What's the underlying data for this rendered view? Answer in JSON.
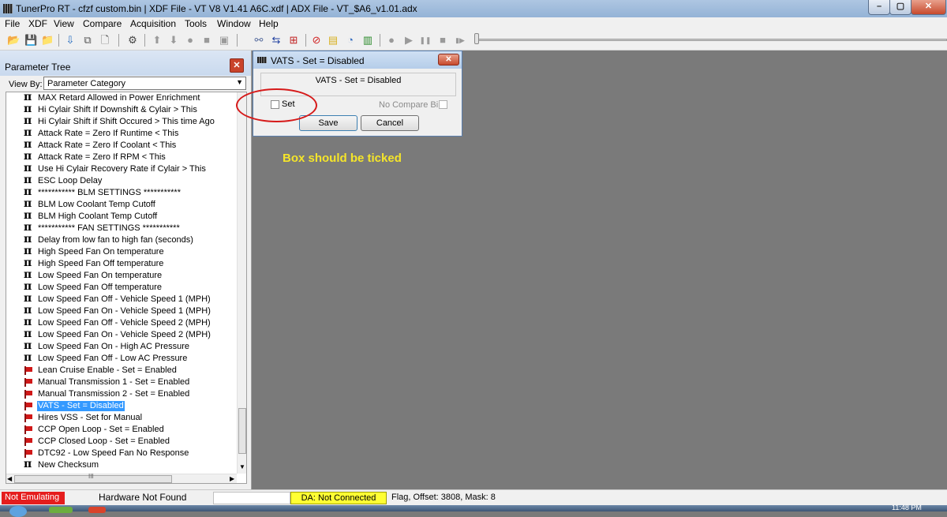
{
  "window": {
    "title": "TunerPro RT - cfzf custom.bin | XDF File - VT V8 V1.41 A6C.xdf | ADX File - VT_$A6_v1.01.adx",
    "min_glyph": "–",
    "max_glyph": "▢",
    "close_glyph": "✕"
  },
  "menu": [
    "File",
    "XDF",
    "View",
    "Compare",
    "Acquisition",
    "Tools",
    "Window",
    "Help"
  ],
  "toolbar": {
    "icons": [
      {
        "name": "open-folder-icon",
        "glyph": "📂"
      },
      {
        "name": "save-icon",
        "glyph": "💾"
      },
      {
        "name": "folder-icon",
        "glyph": "📁"
      },
      {
        "name": "import-icon",
        "glyph": "⇩"
      },
      {
        "name": "compare-icon",
        "glyph": "⧉"
      },
      {
        "name": "new-document-icon",
        "glyph": "🗋"
      },
      {
        "name": "tune-icon",
        "glyph": "⚙"
      },
      {
        "name": "arrow-up-icon",
        "glyph": "⬆"
      },
      {
        "name": "arrow-down-icon",
        "glyph": "⬇"
      },
      {
        "name": "record-icon",
        "glyph": "●"
      },
      {
        "name": "stop-square-icon",
        "glyph": "■"
      },
      {
        "name": "chip-icon",
        "glyph": "▣"
      },
      {
        "name": "connect-icon",
        "glyph": "⚯"
      },
      {
        "name": "swap-icon",
        "glyph": "⇆"
      },
      {
        "name": "emulate-icon",
        "glyph": "⊞"
      },
      {
        "name": "no-entry-icon",
        "glyph": "⊘"
      },
      {
        "name": "notes-icon",
        "glyph": "▤"
      },
      {
        "name": "gauge-icon",
        "glyph": "◔"
      },
      {
        "name": "bar-chart-icon",
        "glyph": "▥"
      },
      {
        "name": "playback-record-icon",
        "glyph": "●"
      },
      {
        "name": "play-icon",
        "glyph": "▶"
      },
      {
        "name": "pause-icon",
        "glyph": "❚❚"
      },
      {
        "name": "stop-icon",
        "glyph": "■"
      },
      {
        "name": "step-icon",
        "glyph": "▮▶"
      }
    ],
    "playback_position": 0
  },
  "panel": {
    "title": "Parameter Tree",
    "close_glyph": "✕",
    "view_by_label": "View By:",
    "view_by_value": "Parameter Category",
    "select_arrow": "▼"
  },
  "tree_items": [
    {
      "icon": "pi",
      "label": "MAX Retard Allowed in Power Enrichment"
    },
    {
      "icon": "pi",
      "label": "Hi Cylair Shift If Downshift & Cylair > This"
    },
    {
      "icon": "pi",
      "label": "Hi Cylair Shift if Shift Occured > This time Ago"
    },
    {
      "icon": "pi",
      "label": "Attack Rate = Zero If Runtime < This"
    },
    {
      "icon": "pi",
      "label": "Attack Rate = Zero If Coolant < This"
    },
    {
      "icon": "pi",
      "label": "Attack Rate = Zero If RPM < This"
    },
    {
      "icon": "pi",
      "label": "Use Hi Cylair Recovery Rate if Cylair > This"
    },
    {
      "icon": "pi",
      "label": "ESC Loop Delay"
    },
    {
      "icon": "pi",
      "label": "*********** BLM SETTINGS ***********"
    },
    {
      "icon": "pi",
      "label": "BLM Low Coolant Temp Cutoff"
    },
    {
      "icon": "pi",
      "label": "BLM High Coolant Temp Cutoff"
    },
    {
      "icon": "pi",
      "label": "*********** FAN SETTINGS ***********"
    },
    {
      "icon": "pi",
      "label": "Delay from low fan to high fan (seconds)"
    },
    {
      "icon": "pi",
      "label": "High Speed Fan On temperature"
    },
    {
      "icon": "pi",
      "label": "High Speed Fan Off temperature"
    },
    {
      "icon": "pi",
      "label": "Low Speed Fan On temperature"
    },
    {
      "icon": "pi",
      "label": "Low Speed Fan Off temperature"
    },
    {
      "icon": "pi",
      "label": "Low Speed Fan Off - Vehicle Speed 1 (MPH)"
    },
    {
      "icon": "pi",
      "label": "Low Speed Fan On - Vehicle Speed 1 (MPH)"
    },
    {
      "icon": "pi",
      "label": "Low Speed Fan Off - Vehicle Speed 2 (MPH)"
    },
    {
      "icon": "pi",
      "label": "Low Speed Fan On - Vehicle Speed 2 (MPH)"
    },
    {
      "icon": "pi",
      "label": "Low Speed Fan On - High AC Pressure"
    },
    {
      "icon": "pi",
      "label": "Low Speed Fan Off - Low AC Pressure"
    },
    {
      "icon": "flag",
      "label": "Lean Cruise Enable - Set = Enabled"
    },
    {
      "icon": "flag",
      "label": "Manual Transmission 1 - Set = Enabled"
    },
    {
      "icon": "flag",
      "label": "Manual Transmission 2 - Set = Enabled"
    },
    {
      "icon": "flag",
      "label": "VATS - Set = Disabled",
      "selected": true
    },
    {
      "icon": "flag",
      "label": "Hires VSS - Set for Manual"
    },
    {
      "icon": "flag",
      "label": "CCP Open Loop - Set = Enabled"
    },
    {
      "icon": "flag",
      "label": "CCP Closed Loop - Set = Enabled"
    },
    {
      "icon": "flag",
      "label": "DTC92 - Low Speed Fan No Response"
    },
    {
      "icon": "pi",
      "label": "New Checksum"
    }
  ],
  "scroll": {
    "up": "▲",
    "down": "▼",
    "left": "◀",
    "right": "▶",
    "grip": "III"
  },
  "dialog": {
    "title": "VATS - Set = Disabled",
    "close_glyph": "✕",
    "description": "VATS - Set = Disabled",
    "set_label": "Set",
    "set_checked": false,
    "no_compare_label": "No Compare Bin",
    "no_compare_checked": false,
    "save_label": "Save",
    "cancel_label": "Cancel"
  },
  "annotation": {
    "text": "Box should be ticked",
    "circle_color": "#d61a1a",
    "text_color": "#f5e52a"
  },
  "status": {
    "emulating": "Not Emulating",
    "hardware": "Hardware Not Found",
    "da": "DA: Not Connected",
    "flag_info": "Flag, Offset: 3808,  Mask: 8"
  },
  "taskbar": {
    "time": "11:48 PM"
  },
  "colors": {
    "selection": "#3399ff",
    "status_red": "#e51d1d",
    "status_yellow": "#ffff33",
    "workspace": "#7a7a7a"
  }
}
